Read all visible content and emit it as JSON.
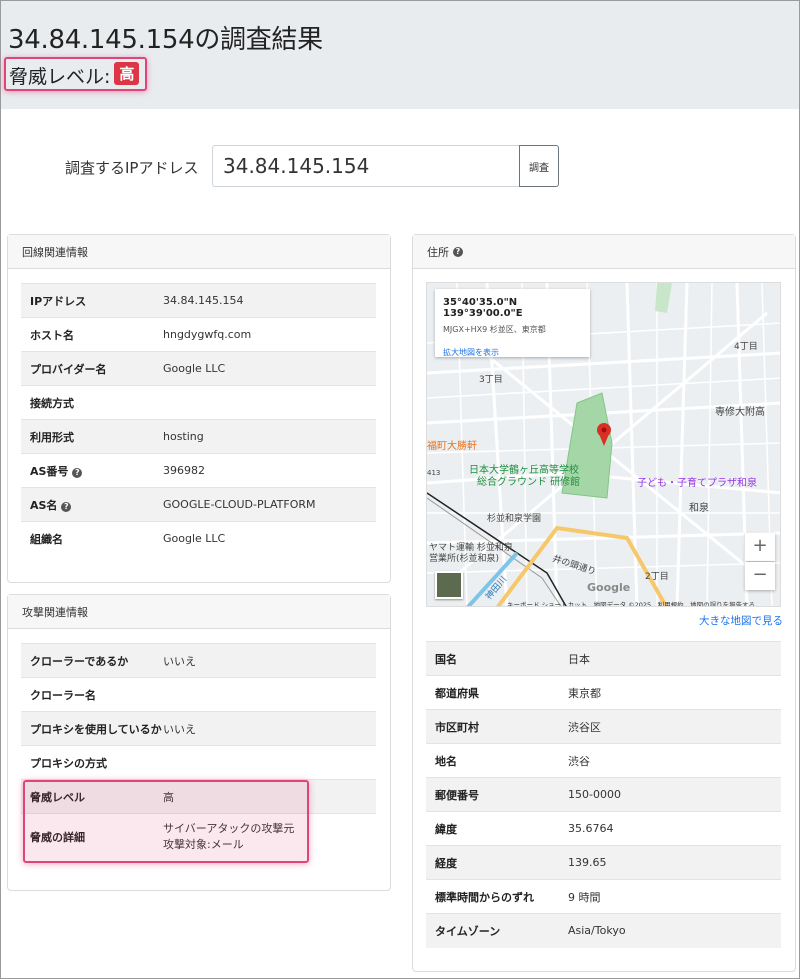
{
  "header": {
    "title": "34.84.145.154の調査結果",
    "threat_label": "脅威レベル:",
    "threat_value": "高"
  },
  "search": {
    "label": "調査するIPアドレス",
    "value": "34.84.145.154",
    "button": "調査"
  },
  "line_info": {
    "header": "回線関連情報",
    "rows": [
      {
        "key": "IPアドレス",
        "value": "34.84.145.154"
      },
      {
        "key": "ホスト名",
        "value": "hngdygwfq.com"
      },
      {
        "key": "プロバイダー名",
        "value": "Google LLC"
      },
      {
        "key": "接続方式",
        "value": ""
      },
      {
        "key": "利用形式",
        "value": "hosting"
      },
      {
        "key": "AS番号",
        "value": "396982",
        "help": true
      },
      {
        "key": "AS名",
        "value": "GOOGLE-CLOUD-PLATFORM",
        "help": true
      },
      {
        "key": "組織名",
        "value": "Google LLC"
      }
    ]
  },
  "attack_info": {
    "header": "攻撃関連情報",
    "rows": [
      {
        "key": "クローラーであるか",
        "value": "いいえ"
      },
      {
        "key": "クローラー名",
        "value": ""
      },
      {
        "key": "プロキシを使用しているか",
        "value": "いいえ"
      },
      {
        "key": "プロキシの方式",
        "value": ""
      },
      {
        "key": "脅威レベル",
        "value": "高"
      },
      {
        "key": "脅威の詳細",
        "value": "サイバーアタックの攻撃元",
        "value2": "攻撃対象:メール"
      }
    ]
  },
  "address": {
    "header": "住所",
    "map": {
      "coords": "35°40'35.0\"N 139°39'00.0\"E",
      "plus_code": "MJGX+HX9 杉並区、東京都",
      "enlarge_link": "拡大地図を表示",
      "labels": [
        "4丁目",
        "3丁目",
        "専修大附高",
        "福町大勝軒",
        "日本大学鶴ヶ丘高等学校",
        "総合グラウンド 研修館",
        "子ども・子育てプラザ和泉",
        "和泉",
        "杉並和泉学園",
        "ヤマト運輸 杉並和泉",
        "営業所(杉並和泉)",
        "井の頭通り",
        "2丁目",
        "神田川",
        "413"
      ],
      "zoom_in": "+",
      "zoom_out": "−",
      "google": "Google",
      "footer": "キーボード ショートカット　地図データ ©2025　利用規約　地図の誤りを報告する"
    },
    "bigger_map": "大きな地図で見る",
    "rows": [
      {
        "key": "国名",
        "value": "日本"
      },
      {
        "key": "都道府県",
        "value": "東京都"
      },
      {
        "key": "市区町村",
        "value": "渋谷区"
      },
      {
        "key": "地名",
        "value": "渋谷"
      },
      {
        "key": "郵便番号",
        "value": "150-0000"
      },
      {
        "key": "緯度",
        "value": "35.6764"
      },
      {
        "key": "経度",
        "value": "139.65"
      },
      {
        "key": "標準時間からのずれ",
        "value": "9 時間"
      },
      {
        "key": "タイムゾーン",
        "value": "Asia/Tokyo"
      }
    ]
  }
}
